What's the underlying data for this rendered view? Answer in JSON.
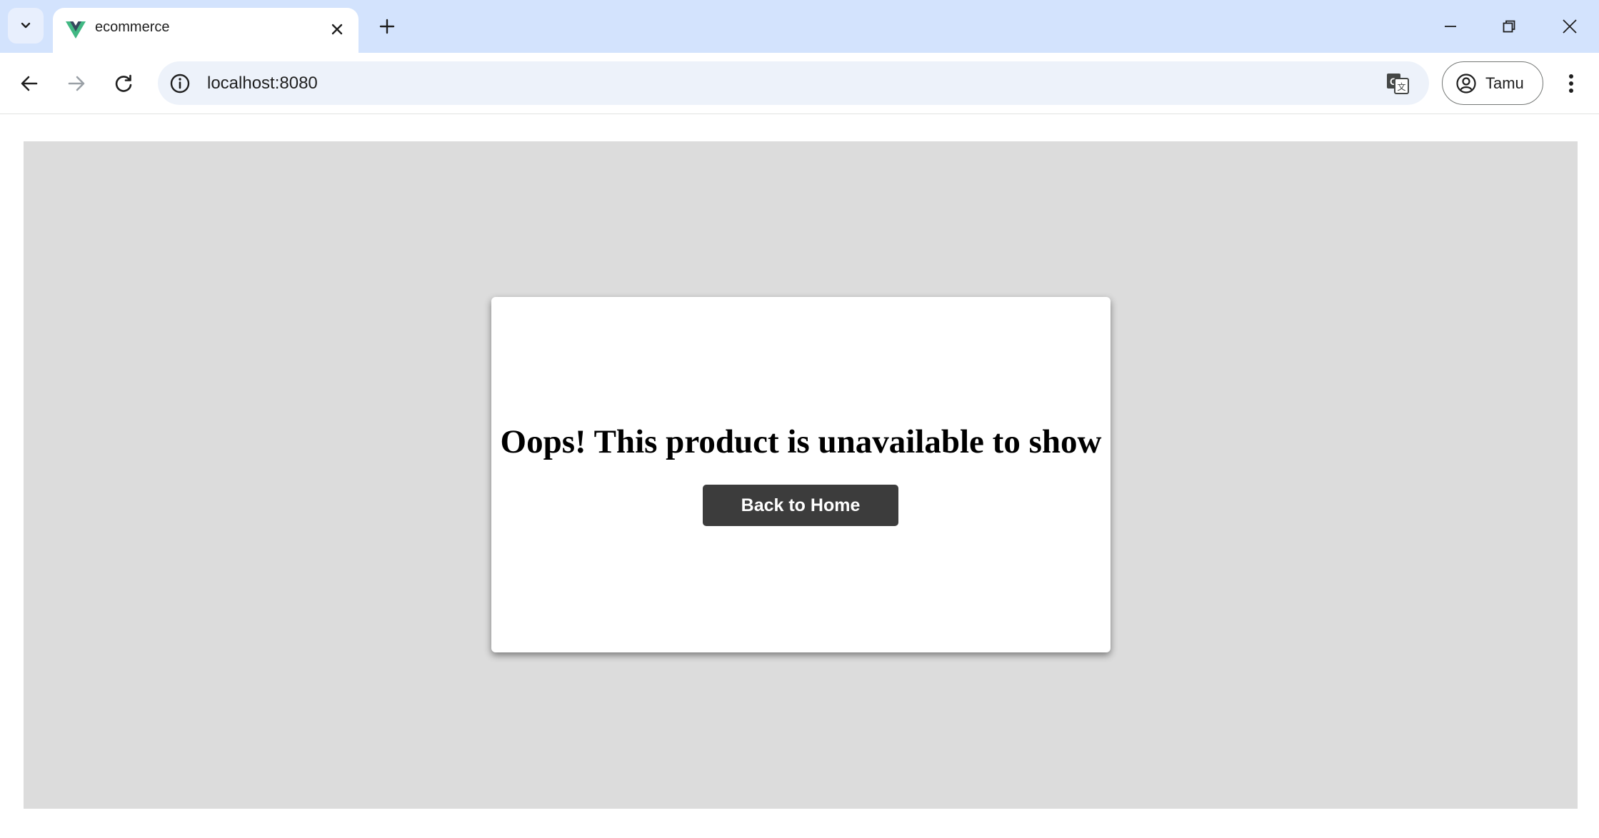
{
  "browser": {
    "tab": {
      "title": "ecommerce",
      "favicon": "vue-logo-icon"
    },
    "url": "localhost:8080",
    "profile_name": "Tamu"
  },
  "page": {
    "message": "Oops! This product is unavailable to show",
    "button_label": "Back to Home"
  },
  "colors": {
    "tabstrip": "#d3e3fd",
    "omnibox": "#edf2fa",
    "stage": "#dcdcdc",
    "button": "#3c3c3c"
  }
}
